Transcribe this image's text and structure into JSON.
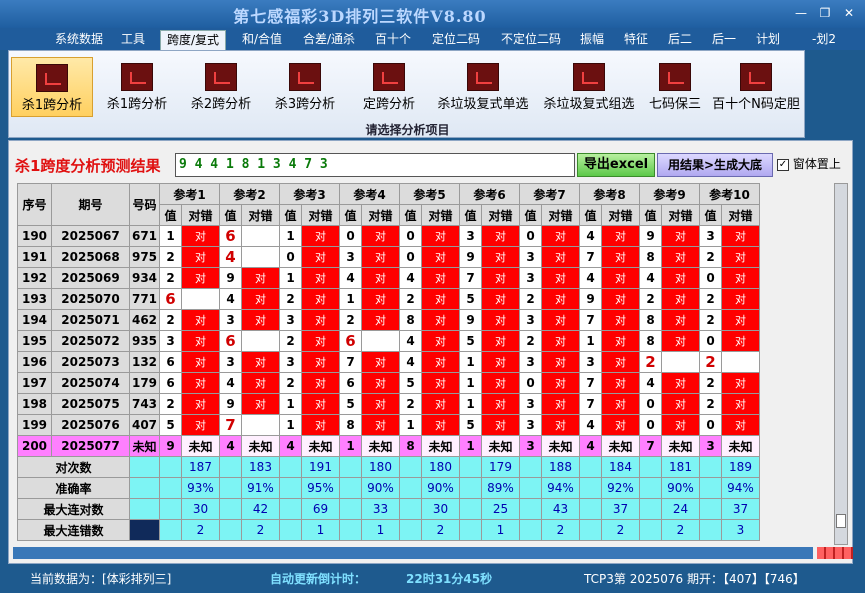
{
  "window": {
    "title": "第七感福彩3D排列三软件V8.80",
    "right_label": "-划2"
  },
  "menu": [
    "系统数据",
    "工具",
    "跨度/复式",
    "和/合值",
    "合差/通杀",
    "百十个",
    "定位二码",
    "不定位二码",
    "振幅",
    "特征",
    "后二",
    "后一",
    "计划"
  ],
  "ribbon": {
    "items": [
      "杀1跨分析",
      "杀1跨分析",
      "杀2跨分析",
      "杀3跨分析",
      "定跨分析",
      "杀垃圾复式单选",
      "杀垃圾复式组选",
      "七码保三",
      "百十个N码定胆"
    ],
    "caption": "请选择分析项目"
  },
  "panel": {
    "title": "杀1跨度分析预测结果",
    "result": "9 4 4 1 8 1 3 4 7 3",
    "export_button": "导出excel",
    "generate_button": "用结果>生成大底",
    "pin_label": "窗体置上"
  },
  "table": {
    "headers": {
      "index": "序号",
      "period": "期号",
      "code": "号码",
      "value": "值",
      "check": "对错",
      "refs": [
        "参考1",
        "参考2",
        "参考3",
        "参考4",
        "参考5",
        "参考6",
        "参考7",
        "参考8",
        "参考9",
        "参考10"
      ]
    },
    "rows": [
      {
        "idx": "190",
        "period": "2025067",
        "code": "671",
        "v": [
          "1",
          "6",
          "1",
          "0",
          "0",
          "3",
          "0",
          "4",
          "9",
          "3"
        ],
        "h": [
          1,
          0,
          1,
          1,
          1,
          1,
          1,
          1,
          1,
          1
        ],
        "b": [
          0,
          1,
          0,
          0,
          0,
          0,
          0,
          0,
          0,
          0
        ]
      },
      {
        "idx": "191",
        "period": "2025068",
        "code": "975",
        "v": [
          "2",
          "4",
          "0",
          "3",
          "0",
          "9",
          "3",
          "7",
          "8",
          "2"
        ],
        "h": [
          1,
          0,
          1,
          1,
          1,
          1,
          1,
          1,
          1,
          1
        ],
        "b": [
          0,
          1,
          0,
          0,
          0,
          0,
          0,
          0,
          0,
          0
        ]
      },
      {
        "idx": "192",
        "period": "2025069",
        "code": "934",
        "v": [
          "2",
          "9",
          "1",
          "4",
          "4",
          "7",
          "3",
          "4",
          "4",
          "0"
        ],
        "h": [
          1,
          1,
          1,
          1,
          1,
          1,
          1,
          1,
          1,
          1
        ],
        "b": [
          0,
          0,
          0,
          0,
          0,
          0,
          0,
          0,
          0,
          0
        ]
      },
      {
        "idx": "193",
        "period": "2025070",
        "code": "771",
        "v": [
          "6",
          "4",
          "2",
          "1",
          "2",
          "5",
          "2",
          "9",
          "2",
          "2"
        ],
        "h": [
          0,
          1,
          1,
          1,
          1,
          1,
          1,
          1,
          1,
          1
        ],
        "b": [
          1,
          0,
          0,
          0,
          0,
          0,
          0,
          0,
          0,
          0
        ]
      },
      {
        "idx": "194",
        "period": "2025071",
        "code": "462",
        "v": [
          "2",
          "3",
          "3",
          "2",
          "8",
          "9",
          "3",
          "7",
          "8",
          "2"
        ],
        "h": [
          1,
          1,
          1,
          1,
          1,
          1,
          1,
          1,
          1,
          1
        ],
        "b": [
          0,
          0,
          0,
          0,
          0,
          0,
          0,
          0,
          0,
          0
        ]
      },
      {
        "idx": "195",
        "period": "2025072",
        "code": "935",
        "v": [
          "3",
          "6",
          "2",
          "6",
          "4",
          "5",
          "2",
          "1",
          "8",
          "0"
        ],
        "h": [
          1,
          0,
          1,
          0,
          1,
          1,
          1,
          1,
          1,
          1
        ],
        "b": [
          0,
          1,
          0,
          1,
          0,
          0,
          0,
          0,
          0,
          0
        ]
      },
      {
        "idx": "196",
        "period": "2025073",
        "code": "132",
        "v": [
          "6",
          "3",
          "3",
          "7",
          "4",
          "1",
          "3",
          "3",
          "2",
          "2"
        ],
        "h": [
          1,
          1,
          1,
          1,
          1,
          1,
          1,
          1,
          0,
          0
        ],
        "b": [
          0,
          0,
          0,
          0,
          0,
          0,
          0,
          0,
          1,
          1
        ]
      },
      {
        "idx": "197",
        "period": "2025074",
        "code": "179",
        "v": [
          "6",
          "4",
          "2",
          "6",
          "5",
          "1",
          "0",
          "7",
          "4",
          "2"
        ],
        "h": [
          1,
          1,
          1,
          1,
          1,
          1,
          1,
          1,
          1,
          1
        ],
        "b": [
          0,
          0,
          0,
          0,
          0,
          0,
          0,
          0,
          0,
          0
        ]
      },
      {
        "idx": "198",
        "period": "2025075",
        "code": "743",
        "v": [
          "2",
          "9",
          "1",
          "5",
          "2",
          "1",
          "3",
          "7",
          "0",
          "2"
        ],
        "h": [
          1,
          1,
          1,
          1,
          1,
          1,
          1,
          1,
          1,
          1
        ],
        "b": [
          0,
          0,
          0,
          0,
          0,
          0,
          0,
          0,
          0,
          0
        ]
      },
      {
        "idx": "199",
        "period": "2025076",
        "code": "407",
        "v": [
          "5",
          "7",
          "1",
          "8",
          "1",
          "5",
          "3",
          "4",
          "0",
          "0"
        ],
        "h": [
          1,
          0,
          1,
          1,
          1,
          1,
          1,
          1,
          1,
          1
        ],
        "b": [
          0,
          1,
          0,
          0,
          0,
          0,
          0,
          0,
          0,
          0
        ]
      }
    ],
    "future": {
      "idx": "200",
      "period": "2025077",
      "code": "未知",
      "v": [
        "9",
        "4",
        "4",
        "1",
        "8",
        "1",
        "3",
        "4",
        "7",
        "3"
      ],
      "unknown": "未知"
    },
    "stats": [
      {
        "label": "对次数",
        "values": [
          "187",
          "183",
          "191",
          "180",
          "180",
          "179",
          "188",
          "184",
          "181",
          "189"
        ]
      },
      {
        "label": "准确率",
        "values": [
          "93%",
          "91%",
          "95%",
          "90%",
          "90%",
          "89%",
          "94%",
          "92%",
          "90%",
          "94%"
        ]
      },
      {
        "label": "最大连对数",
        "values": [
          "30",
          "42",
          "69",
          "33",
          "30",
          "25",
          "43",
          "37",
          "24",
          "37"
        ]
      },
      {
        "label": "最大连错数",
        "values": [
          "2",
          "2",
          "1",
          "1",
          "2",
          "1",
          "2",
          "2",
          "2",
          "3"
        ]
      }
    ],
    "hit_text": "对"
  },
  "status": {
    "current": "当前数据为：[体彩排列三]",
    "countdown_label": "自动更新倒计时：",
    "countdown": "22时31分45秒",
    "period": "TCP3第 2025076 期开：【407】【746】"
  }
}
